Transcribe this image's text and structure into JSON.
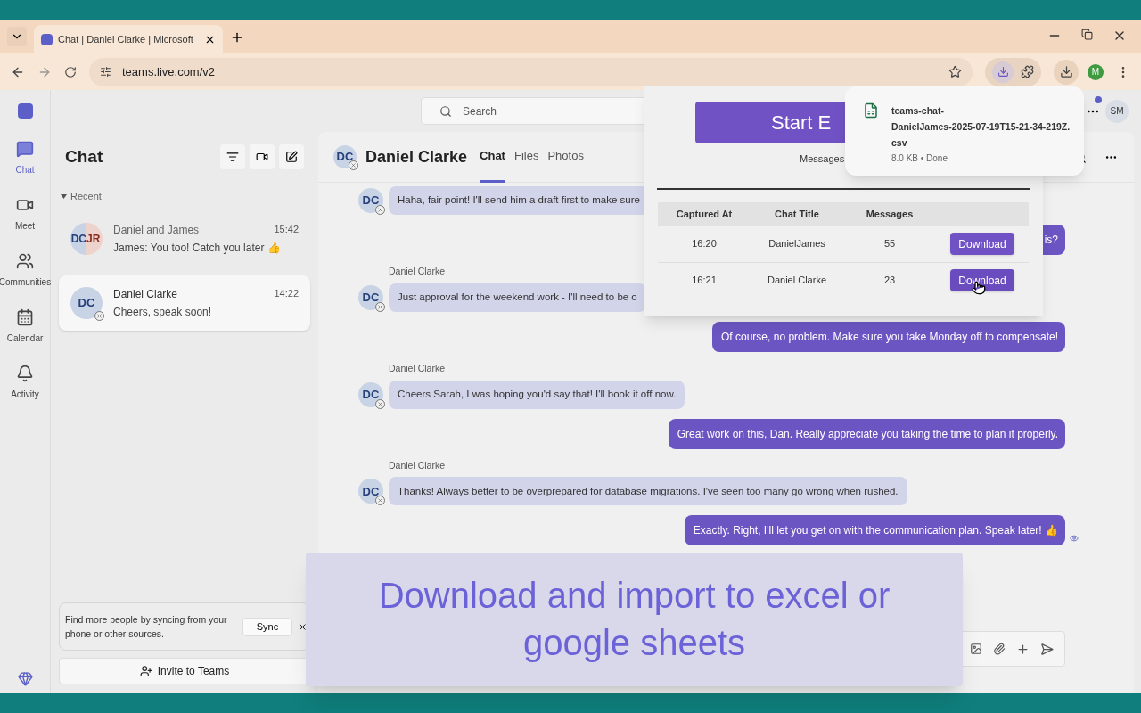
{
  "browser": {
    "tab_title": "Chat | Daniel Clarke | Microsoft",
    "url": "teams.live.com/v2",
    "profile": "M"
  },
  "teams": {
    "search_placeholder": "Search",
    "user_initials": "SM",
    "notification": true,
    "rail": [
      {
        "kind": "chat",
        "label": "Chat",
        "selected": true
      },
      {
        "kind": "meet",
        "label": "Meet",
        "selected": false
      },
      {
        "kind": "communities",
        "label": "Communities",
        "selected": false
      },
      {
        "kind": "calendar",
        "label": "Calendar",
        "selected": false
      },
      {
        "kind": "activity",
        "label": "Activity",
        "selected": false
      }
    ]
  },
  "chat_list": {
    "title": "Chat",
    "section": "Recent",
    "expanded": true,
    "items": [
      {
        "kind": "group",
        "initials": [
          "DC",
          "JR"
        ],
        "name": "Daniel and James",
        "time": "15:42",
        "preview": "James: You too! Catch you later 👍",
        "selected": false
      },
      {
        "kind": "single",
        "initials": [
          "DC"
        ],
        "name": "Daniel Clarke",
        "time": "14:22",
        "preview": "Cheers, speak soon!",
        "selected": true
      }
    ],
    "sync_card": {
      "text": "Find more people by syncing from your phone or other sources.",
      "button": "Sync"
    },
    "invite_button": "Invite to Teams"
  },
  "conversation": {
    "initials": "DC",
    "name": "Daniel Clarke",
    "tabs": [
      {
        "label": "Chat",
        "selected": true
      },
      {
        "label": "Files",
        "selected": false
      },
      {
        "label": "Photos",
        "selected": false
      }
    ],
    "messages": [
      {
        "kind": "incoming",
        "initials": "DC",
        "text": "Haha, fair point! I'll send him a draft first to make sure"
      },
      {
        "kind": "outgoing",
        "text": "is?",
        "seen": false
      },
      {
        "kind": "incoming",
        "initials": "DC",
        "author": "Daniel Clarke",
        "text": "Just approval for the weekend work - I'll need to be o"
      },
      {
        "kind": "outgoing",
        "text": "Of course, no problem. Make sure you take Monday off to compensate!",
        "seen": false
      },
      {
        "kind": "incoming",
        "initials": "DC",
        "author": "Daniel Clarke",
        "text": "Cheers Sarah, I was hoping you'd say that! I'll book it off now."
      },
      {
        "kind": "outgoing",
        "text": "Great work on this, Dan. Really appreciate you taking the time to plan it properly.",
        "seen": false
      },
      {
        "kind": "incoming",
        "initials": "DC",
        "author": "Daniel Clarke",
        "text": "Thanks! Always better to be overprepared for database migrations. I've seen too many go wrong when rushed."
      },
      {
        "kind": "outgoing",
        "text": "Exactly. Right, I'll let you get on with the communication plan. Speak later! 👍",
        "seen": true
      }
    ]
  },
  "extension_popup": {
    "start_button": "Start E",
    "status": "Messages",
    "columns": [
      "Captured At",
      "Chat Title",
      "Messages"
    ],
    "rows": [
      {
        "captured_at": "16:20",
        "chat_title": "DanielJames",
        "messages": "55",
        "action": "Download",
        "hovered": false
      },
      {
        "captured_at": "16:21",
        "chat_title": "Daniel Clarke",
        "messages": "23",
        "action": "Download",
        "hovered": true
      }
    ]
  },
  "download_bubble": {
    "file_name_lines": [
      "teams-chat-",
      "DanielJames-2025-07-19T15-21-34-219Z.",
      "csv"
    ],
    "status": "8.0 KB • Done"
  },
  "caption": "Download and import to excel or google sheets"
}
